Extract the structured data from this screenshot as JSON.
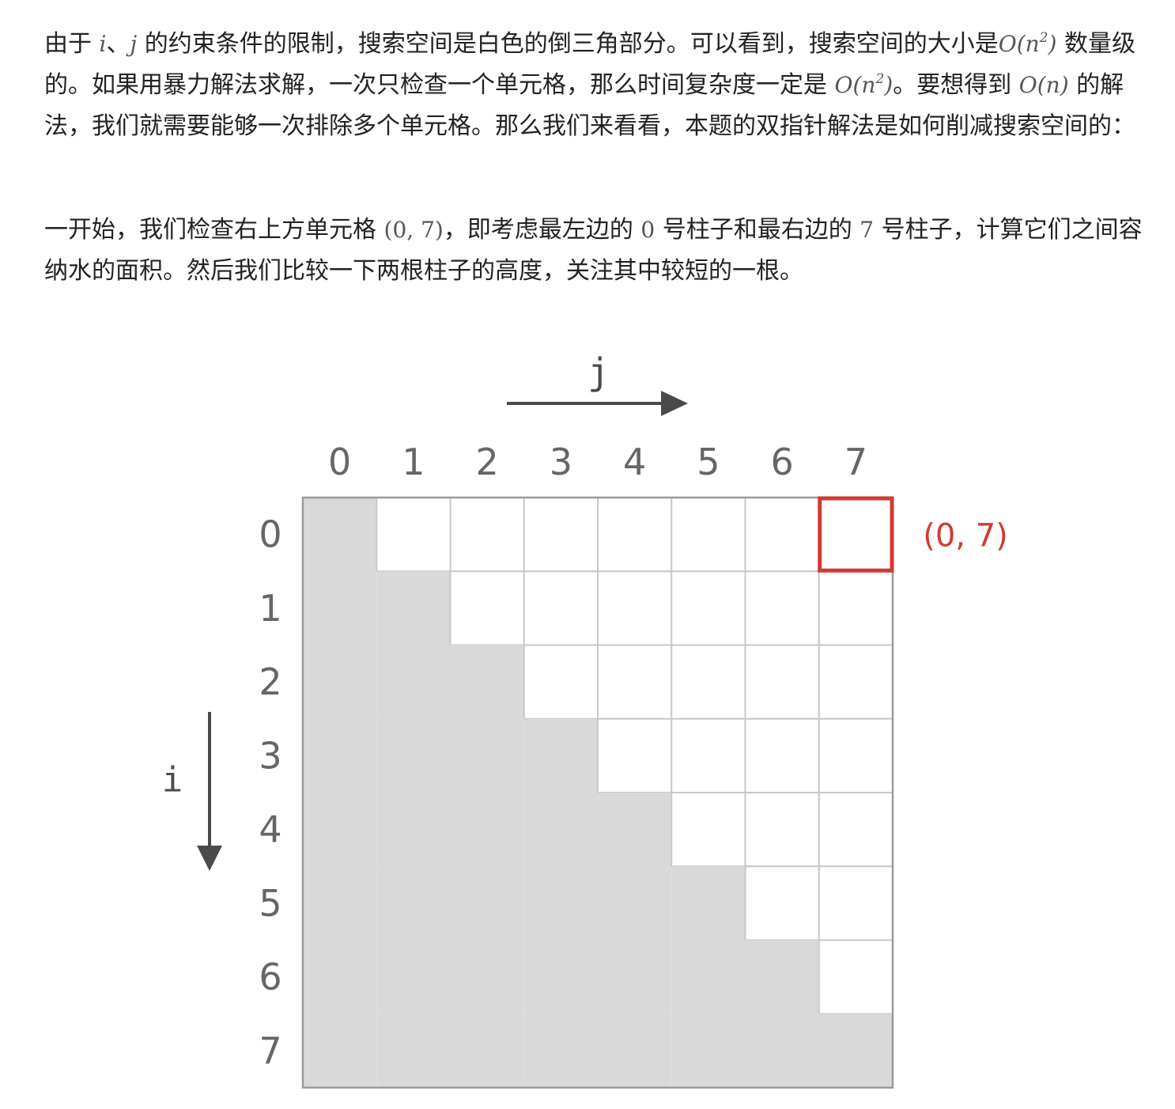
{
  "paragraphs": [
    {
      "runs": [
        {
          "t": "由于 "
        },
        {
          "m": "i"
        },
        {
          "t": "、"
        },
        {
          "m": "j"
        },
        {
          "t": " 的约束条件的限制，搜索空间是白色的倒三角部分。可以看到，搜索空间的大小是"
        },
        {
          "m": "O(n",
          "sup": "2",
          "close": ")"
        },
        {
          "t": " 数量级的。如果用暴力解法求解，一次只检查一个单元格，那么时间复杂度一定是 "
        },
        {
          "m": "O(n",
          "sup": "2",
          "close": ")"
        },
        {
          "t": "。要想得到 "
        },
        {
          "m": "O(n)"
        },
        {
          "t": " 的解法，我们就需要能够一次排除多个单元格。那么我们来看看，本题的双指针解法是如何削减搜索空间的："
        }
      ]
    },
    {
      "runs": [
        {
          "t": "一开始，我们检查右上方单元格 "
        },
        {
          "mu": "(0, 7)"
        },
        {
          "t": "，即考虑最左边的 "
        },
        {
          "mu": "0"
        },
        {
          "t": " 号柱子和最右边的 "
        },
        {
          "mu": "7"
        },
        {
          "t": " 号柱子，计算它们之间容纳水的面积。然后我们比较一下两根柱子的高度，关注其中较短的一根。"
        }
      ]
    }
  ],
  "diagram": {
    "j_label": "j",
    "i_label": "i",
    "col_labels": [
      "0",
      "1",
      "2",
      "3",
      "4",
      "5",
      "6",
      "7"
    ],
    "row_labels": [
      "0",
      "1",
      "2",
      "3",
      "4",
      "5",
      "6",
      "7"
    ],
    "grid_size": 8,
    "search_space_rule": "cell (i, j) is white when j > i, gray otherwise",
    "highlight_cell": {
      "row": 0,
      "col": 7
    },
    "highlight_label": "(0, 7)",
    "colors": {
      "gray": "#d9d9d9",
      "white": "#ffffff",
      "grid_line": "#c8c8c8",
      "border": "#9a9a9a",
      "label": "#666666",
      "arrow": "#4a4a4a",
      "highlight": "#d23a32"
    }
  }
}
